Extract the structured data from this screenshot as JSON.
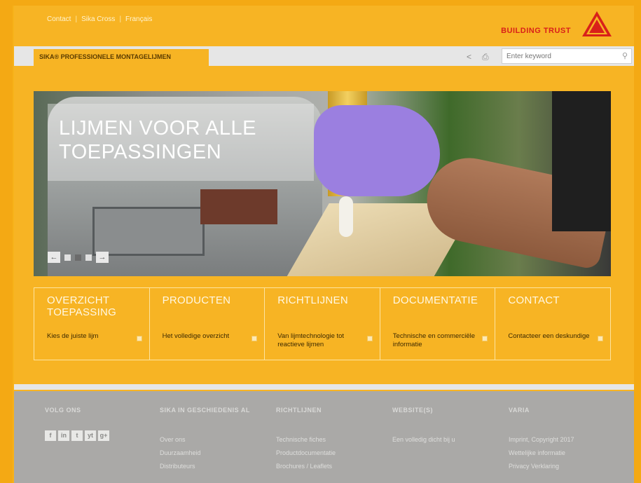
{
  "top_links": [
    "Contact",
    "Sika Cross",
    "Français"
  ],
  "brand": {
    "slogan": "BUILDING TRUST"
  },
  "nav": {
    "tab_label": "SIKA® PROFESSIONELE MONTAGELIJMEN"
  },
  "search": {
    "placeholder": "Enter keyword"
  },
  "hero": {
    "caption_lines": [
      "LIJMEN VOOR ALLE",
      "TOEPASSINGEN"
    ],
    "slides": 3,
    "active_slide": 2
  },
  "tiles": [
    {
      "title_lines": [
        "OVERZICHT",
        "TOEPASSING"
      ],
      "link": "Kies de juiste lijm"
    },
    {
      "title_lines": [
        "PRODUCTEN"
      ],
      "link": "Het volledige overzicht"
    },
    {
      "title_lines": [
        "RICHTLIJNEN"
      ],
      "link": "Van lijmtechnologie tot reactieve lijmen"
    },
    {
      "title_lines": [
        "DOCUMENTATIE"
      ],
      "link": "Technische en commerciële informatie"
    },
    {
      "title_lines": [
        "CONTACT"
      ],
      "link": "Contacteer een deskundige"
    }
  ],
  "footer": {
    "columns": [
      {
        "heading": "VOLG ONS",
        "items": []
      },
      {
        "heading": "SIKA IN GESCHIEDENIS AL",
        "items": [
          "Over ons",
          "Duurzaamheid",
          "Distributeurs"
        ]
      },
      {
        "heading": "RICHTLIJNEN",
        "items": [
          "Technische fiches",
          "Productdocumentatie",
          "Brochures / Leaflets"
        ]
      },
      {
        "heading": "WEBSITE(S)",
        "items": [
          "Een volledig dicht bij u"
        ]
      },
      {
        "heading": "VARIA",
        "items": [
          "Imprint, Copyright 2017",
          "Wettelijke informatie",
          "Privacy Verklaring"
        ]
      }
    ],
    "social_icons": [
      "f",
      "in",
      "t",
      "yt",
      "g+"
    ]
  },
  "colors": {
    "accent": "#f7b424",
    "brand_red": "#d9201a",
    "footer": "#aaa9a7"
  }
}
